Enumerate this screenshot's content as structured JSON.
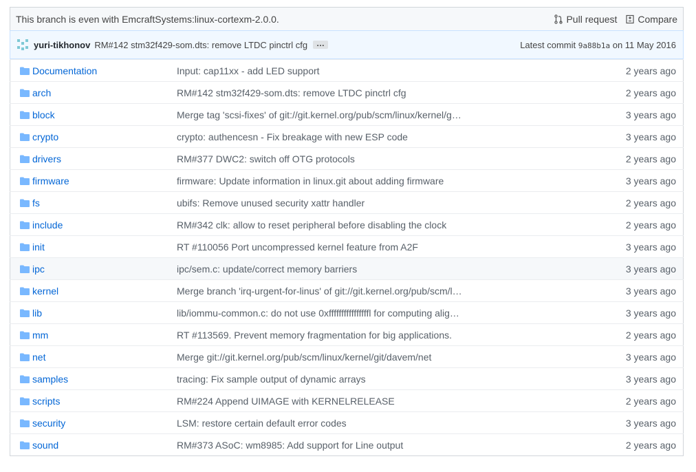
{
  "branch": {
    "status": "This branch is even with EmcraftSystems:linux-cortexm-2.0.0.",
    "pull_request_label": "Pull request",
    "compare_label": "Compare"
  },
  "commit": {
    "author": "yuri-tikhonov",
    "message": "RM#142 stm32f429-som.dts: remove LTDC pinctrl cfg",
    "ellipsis": "…",
    "latest_label": "Latest commit",
    "sha": "9a88b1a",
    "date": "on 11 May 2016"
  },
  "files": [
    {
      "name": "Documentation",
      "message": "Input: cap11xx - add LED support",
      "age": "2 years ago"
    },
    {
      "name": "arch",
      "message": "RM#142 stm32f429-som.dts: remove LTDC pinctrl cfg",
      "age": "2 years ago"
    },
    {
      "name": "block",
      "message": "Merge tag 'scsi-fixes' of git://git.kernel.org/pub/scm/linux/kernel/g…",
      "age": "3 years ago"
    },
    {
      "name": "crypto",
      "message": "crypto: authencesn - Fix breakage with new ESP code",
      "age": "3 years ago"
    },
    {
      "name": "drivers",
      "message": "RM#377 DWC2: switch off OTG protocols",
      "age": "2 years ago"
    },
    {
      "name": "firmware",
      "message": "firmware: Update information in linux.git about adding firmware",
      "age": "3 years ago"
    },
    {
      "name": "fs",
      "message": "ubifs: Remove unused security xattr handler",
      "age": "2 years ago"
    },
    {
      "name": "include",
      "message": "RM#342 clk: allow to reset peripheral before disabling the clock",
      "age": "2 years ago"
    },
    {
      "name": "init",
      "message": "RT #110056 Port uncompressed kernel feature from A2F",
      "age": "3 years ago"
    },
    {
      "name": "ipc",
      "message": "ipc/sem.c: update/correct memory barriers",
      "age": "3 years ago"
    },
    {
      "name": "kernel",
      "message": "Merge branch 'irq-urgent-for-linus' of git://git.kernel.org/pub/scm/l…",
      "age": "3 years ago"
    },
    {
      "name": "lib",
      "message": "lib/iommu-common.c: do not use 0xffffffffffffffffl for computing alig…",
      "age": "3 years ago"
    },
    {
      "name": "mm",
      "message": "RT #113569. Prevent memory fragmentation for big applications.",
      "age": "2 years ago"
    },
    {
      "name": "net",
      "message": "Merge git://git.kernel.org/pub/scm/linux/kernel/git/davem/net",
      "age": "3 years ago"
    },
    {
      "name": "samples",
      "message": "tracing: Fix sample output of dynamic arrays",
      "age": "3 years ago"
    },
    {
      "name": "scripts",
      "message": "RM#224 Append UIMAGE with KERNELRELEASE",
      "age": "2 years ago"
    },
    {
      "name": "security",
      "message": "LSM: restore certain default error codes",
      "age": "3 years ago"
    },
    {
      "name": "sound",
      "message": "RM#373 ASoC: wm8985: Add support for Line output",
      "age": "2 years ago"
    }
  ],
  "colors": {
    "link": "#0366d6",
    "folder_icon": "#79b8ff",
    "commit_bar_bg": "#f1f8ff"
  },
  "icons": {
    "folder": "folder-icon",
    "pull_request": "pull-request-icon",
    "compare": "compare-icon",
    "avatar": "avatar"
  }
}
